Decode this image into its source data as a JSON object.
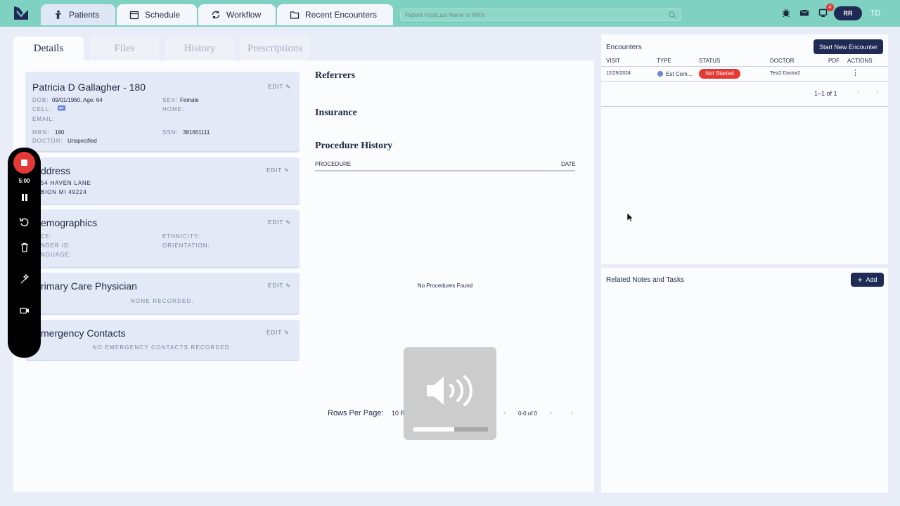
{
  "topnav": {
    "tabs": [
      {
        "label": "Patients",
        "icon": "person-icon"
      },
      {
        "label": "Schedule",
        "icon": "calendar-icon"
      },
      {
        "label": "Workflow",
        "icon": "sync-icon"
      },
      {
        "label": "Recent Encounters",
        "icon": "folder-icon"
      }
    ],
    "search_placeholder": "Patient First/Last Name or MRN",
    "notification_count": "4",
    "user_initials": "RR",
    "account_initials": "TD"
  },
  "detail_tabs": [
    "Details",
    "Files",
    "History",
    "Prescriptions"
  ],
  "patient": {
    "name": "Patricia D Gallagher - 180",
    "edit_label": "EDIT",
    "dob_label": "DOB:",
    "dob_value": "09/01/1960, Age: 64",
    "sex_label": "SEX:",
    "sex_value": "Female",
    "cell_label": "CELL:",
    "home_label": "HOME:",
    "email_label": "EMAIL:",
    "mrn_label": "MRN:",
    "mrn_value": "180",
    "ssn_label": "SSN:",
    "ssn_value": "381661111",
    "doctor_label": "DOCTOR:",
    "doctor_value": "Unspecified"
  },
  "address": {
    "title": "ddress",
    "edit_label": "EDIT",
    "line1": "54 HAVEN LANE",
    "line2": "BION MI 49224"
  },
  "demographics": {
    "title": "emographics",
    "edit_label": "EDIT",
    "race_label": "CE:",
    "ethnicity_label": "ETHNICITY:",
    "gender_label": "NDER ID:",
    "orientation_label": "ORIENTATION:",
    "language_label": "NGUAGE:"
  },
  "pcp": {
    "title": "rimary Care Physician",
    "edit_label": "EDIT",
    "empty": "NONE RECORDED."
  },
  "emergency": {
    "title": "mergency Contacts",
    "edit_label": "EDIT",
    "empty": "NO EMERGENCY CONTACTS RECORDED."
  },
  "middle": {
    "referrers": "Referrers",
    "insurance": "Insurance",
    "procedure_history": "Procedure History",
    "col_procedure": "PROCEDURE",
    "col_date": "DATE",
    "empty": "No Procedures Found",
    "rows_per_page_label": "Rows Per Page:",
    "rows_per_page_value": "10 R",
    "pagination": "0-0 of 0"
  },
  "encounters": {
    "title": "Encounters",
    "start_button": "Start New Encounter",
    "columns": [
      "VISIT",
      "TYPE",
      "STATUS",
      "DOCTOR",
      "PDF",
      "ACTIONS"
    ],
    "row": {
      "visit": "12/29/2024",
      "type": "Est Com...",
      "status": "Not Started",
      "doctor": "Test2 Doctor2"
    },
    "pagination": "1–1 of 1"
  },
  "notes": {
    "title": "Related Notes and Tasks",
    "add_button": "Add"
  },
  "recorder": {
    "timer": "5:00"
  },
  "volume_level": 0.55
}
